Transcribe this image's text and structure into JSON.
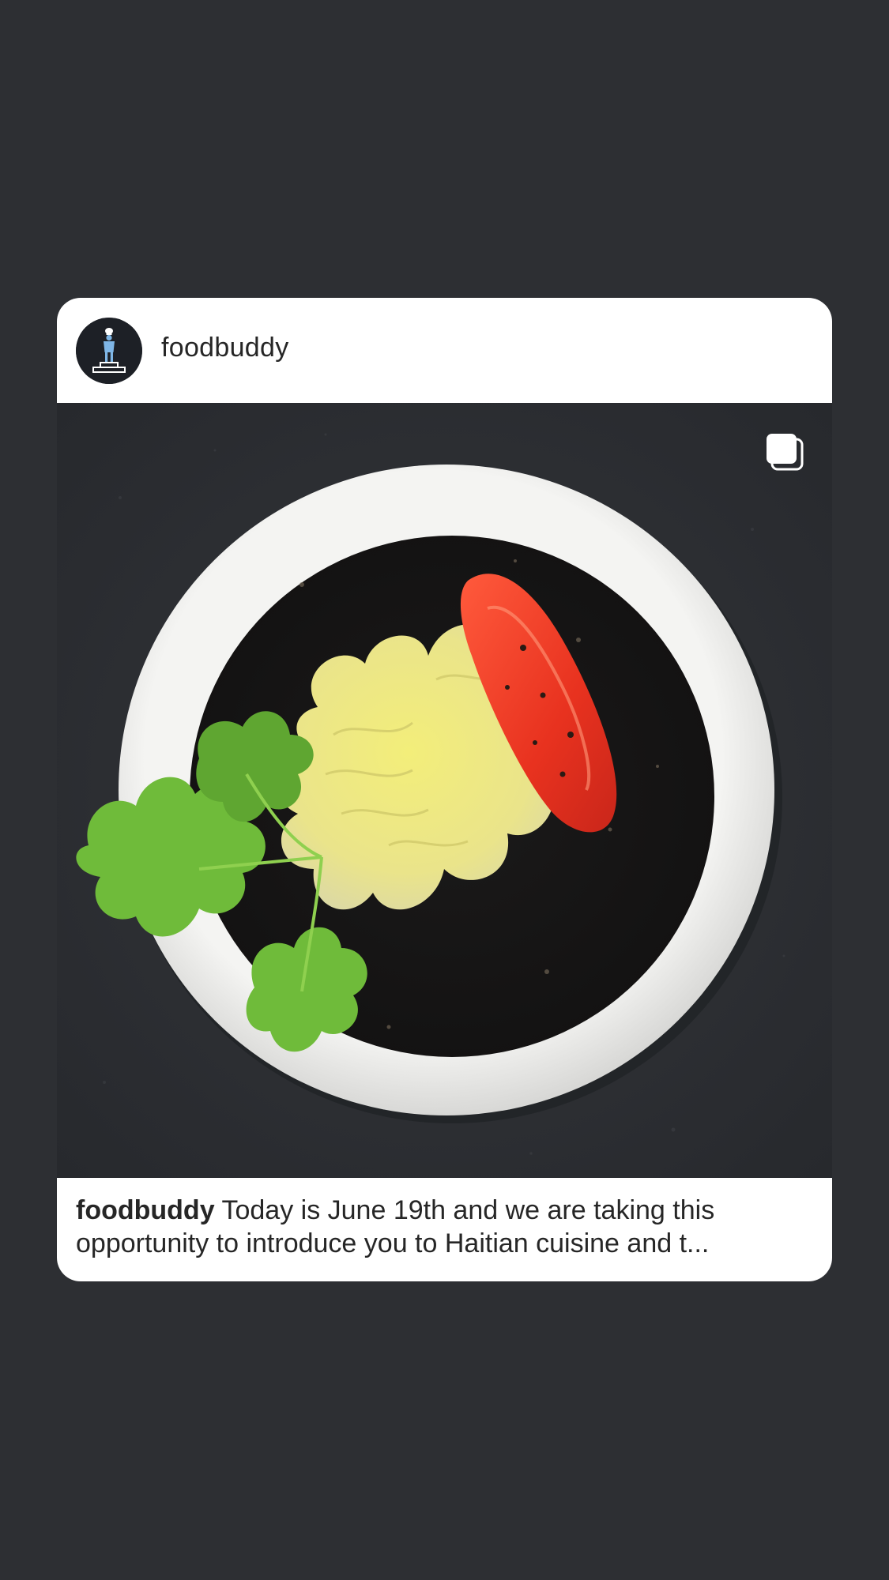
{
  "post": {
    "username": "foodbuddy",
    "caption_user": "foodbuddy",
    "caption_line1": "Today is June 19th and we are  taking this",
    "caption_line2": "opportunity to introduce you to Haitian cuisine and t...",
    "avatar_icon": "chef-on-pedestal-icon",
    "media_icon": "multiple-images-icon"
  },
  "colors": {
    "background": "#2d2f33",
    "card": "#ffffff",
    "text": "#262626",
    "avatar_bg": "#1d2026",
    "avatar_figure": "#7fb6e6"
  }
}
